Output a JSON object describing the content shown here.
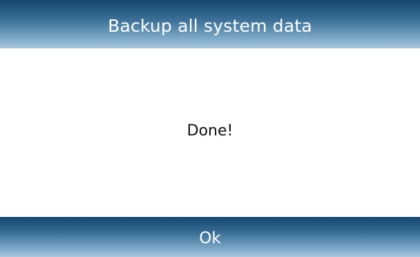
{
  "dialog": {
    "title": "Backup all system data",
    "message": "Done!",
    "ok_label": "Ok"
  },
  "colors": {
    "bar_dark": "#15456d",
    "bar_light": "#a9c9de",
    "text_light": "#ffffff",
    "text_dark": "#111111",
    "background": "#ffffff"
  }
}
